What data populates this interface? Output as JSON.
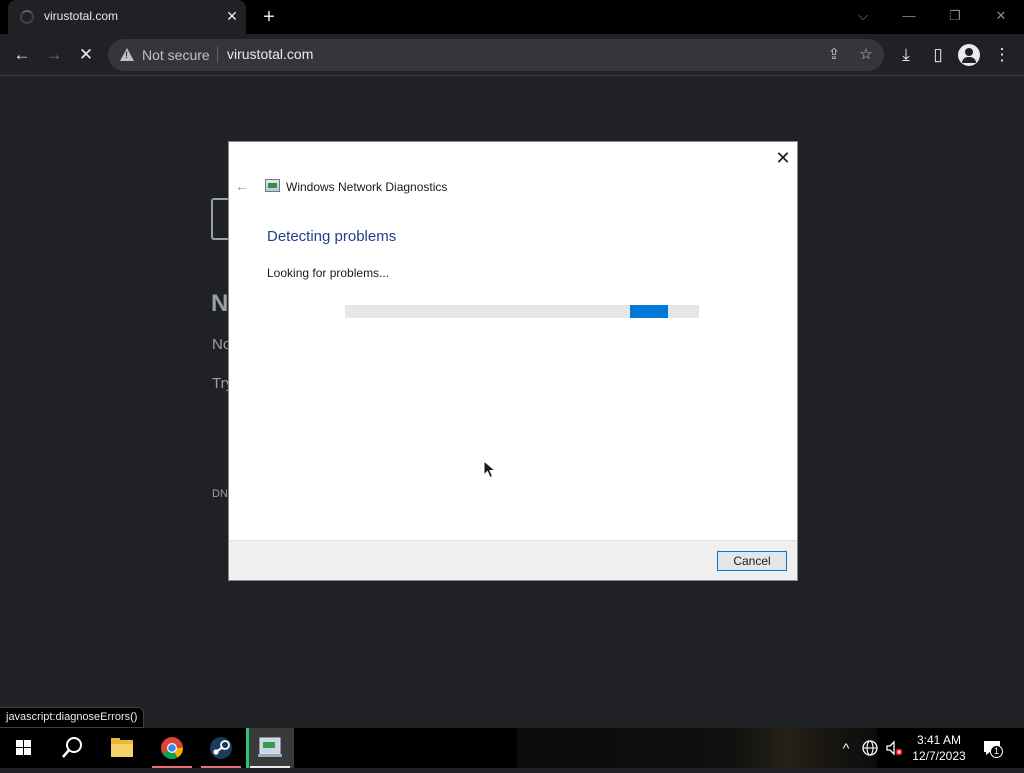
{
  "browser": {
    "tab": {
      "title": "virustotal.com",
      "close_glyph": "✕"
    },
    "new_tab_glyph": "+",
    "window_controls": {
      "dropdown": "⌵",
      "minimize": "—",
      "restore": "❐",
      "close": "✕"
    },
    "toolbar": {
      "back_glyph": "←",
      "forward_glyph": "→",
      "stop_glyph": "✕",
      "security_label": "Not secure",
      "url": "virustotal.com",
      "share_glyph": "⇪",
      "star_glyph": "☆",
      "download_glyph": "⤓",
      "sidepanel_glyph": "▯",
      "menu_glyph": "⋮"
    },
    "status_bubble": "javascript:diagnoseErrors()"
  },
  "background_page": {
    "heading_fragment": "N",
    "line1_fragment": "No",
    "line2_fragment": "Try",
    "code_fragment": "DN"
  },
  "dialog": {
    "close_glyph": "✕",
    "back_glyph": "←",
    "app_title": "Windows Network Diagnostics",
    "heading": "Detecting problems",
    "status": "Looking for problems...",
    "progress_indeterminate": true,
    "cancel_label": "Cancel",
    "colors": {
      "heading": "#1e3f8a",
      "progress": "#0078d7"
    }
  },
  "taskbar": {
    "tray_chevron": "^",
    "clock_time": "3:41 AM",
    "clock_date": "12/7/2023",
    "notification_count": "1",
    "items": [
      "start-icon",
      "search-icon",
      "file-explorer-icon",
      "chrome-icon",
      "steam-icon",
      "network-diagnostics-icon"
    ]
  }
}
